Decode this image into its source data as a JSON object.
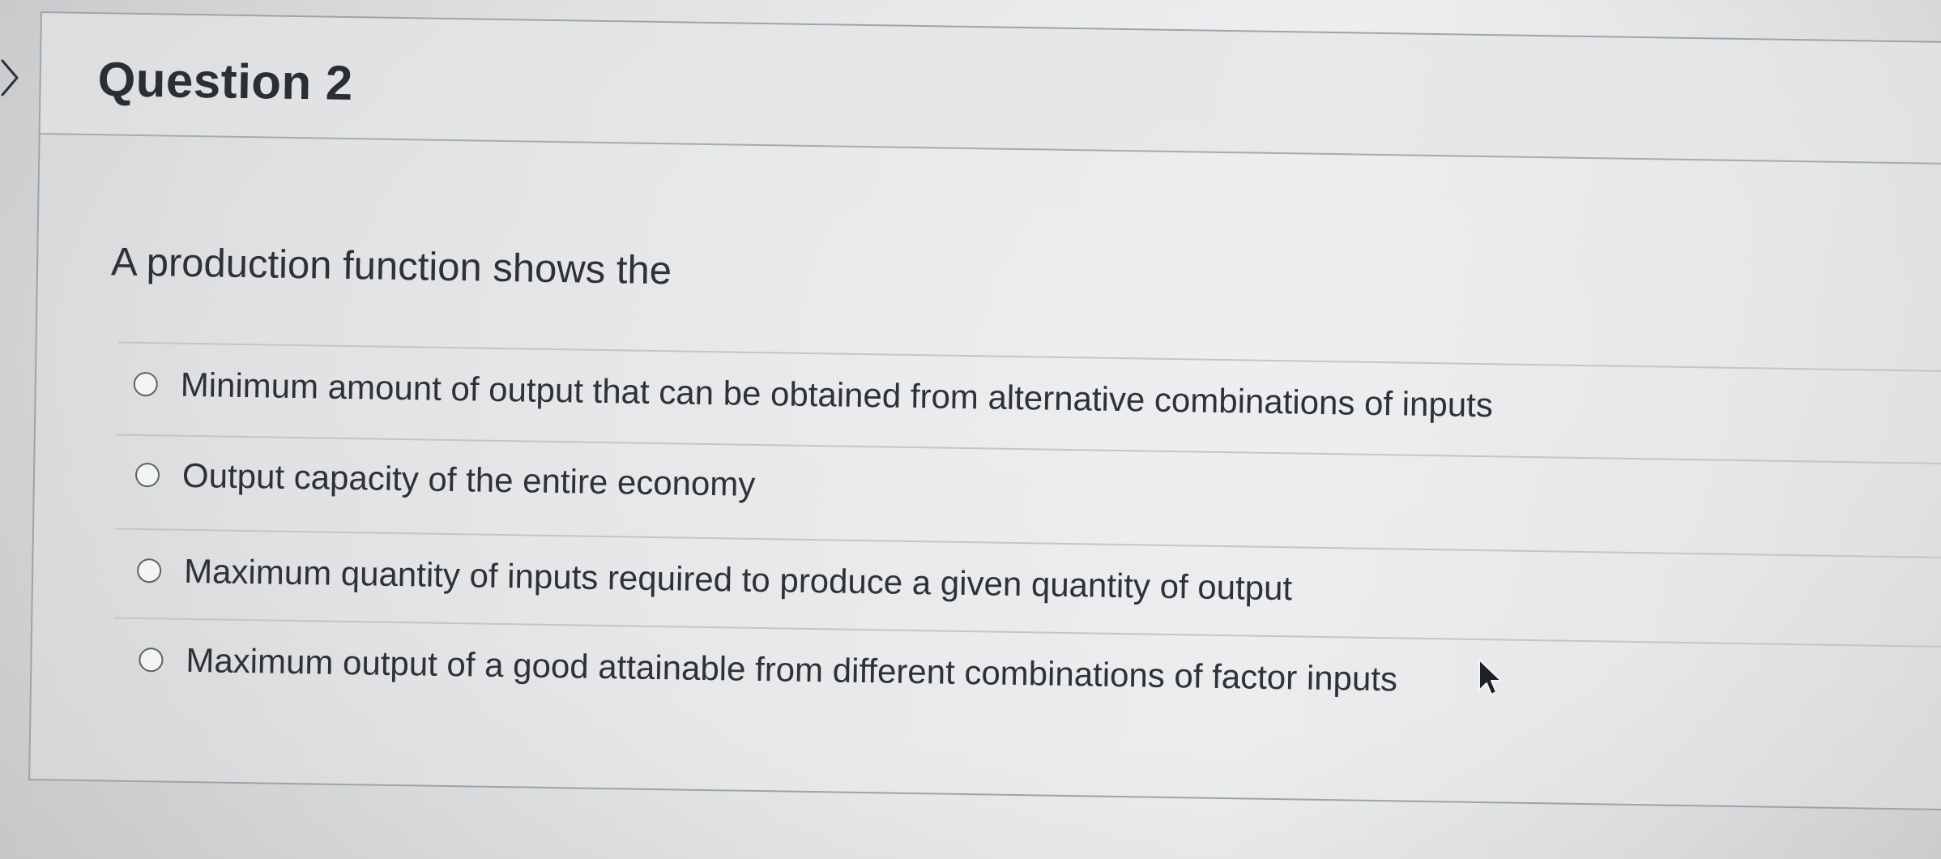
{
  "question": {
    "title": "Question 2",
    "prompt": "A production function shows the",
    "options": [
      {
        "label": "Minimum amount of output that can be obtained from alternative combinations of inputs",
        "selected": false
      },
      {
        "label": "Output capacity of the entire economy",
        "selected": false
      },
      {
        "label": "Maximum quantity of inputs required to produce a given quantity of output",
        "selected": false
      },
      {
        "label": "Maximum output of a good attainable from different combinations of factor inputs",
        "selected": false
      }
    ]
  },
  "icons": {
    "collapse": "chevron-right-icon",
    "cursor": "mouse-pointer-icon",
    "option_marker": "radio-button"
  },
  "colors": {
    "text": "#2a2e33",
    "border": "#9ea3a7",
    "background": "#e6e8e9"
  }
}
